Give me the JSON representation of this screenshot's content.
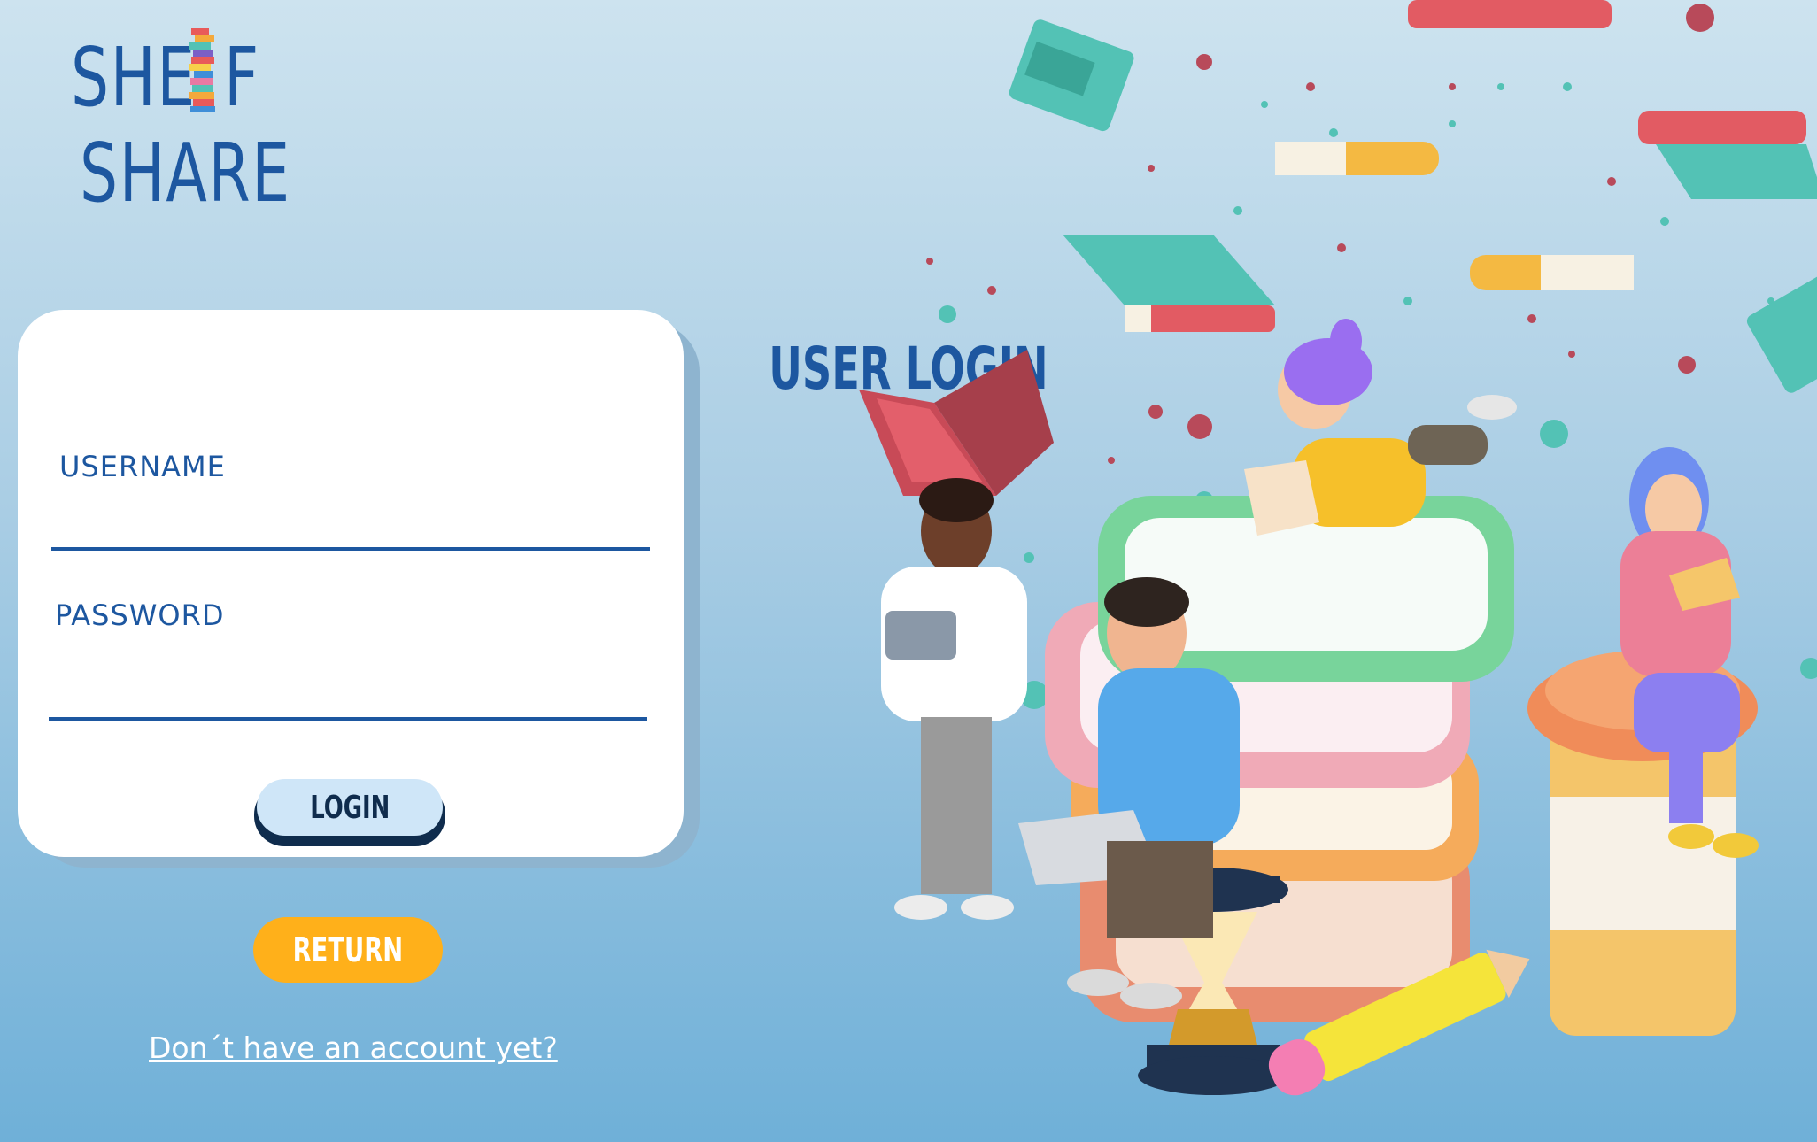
{
  "brand": {
    "line1_start": "SHE",
    "line1_end": "F",
    "line2": "SHARE"
  },
  "login_card": {
    "title": "USER LOGIN",
    "username_label": "USERNAME",
    "username_value": "",
    "password_label": "PASSWORD",
    "password_value": "",
    "login_button": "LOGIN"
  },
  "return_button": "RETURN",
  "register_link": "Don´t have an account yet?",
  "colors": {
    "brand_blue": "#1d57a0",
    "return_orange": "#ffb01a",
    "login_button_bg": "#cfe6f8"
  },
  "illustration": {
    "icon": "people-reading-books-illustration"
  }
}
